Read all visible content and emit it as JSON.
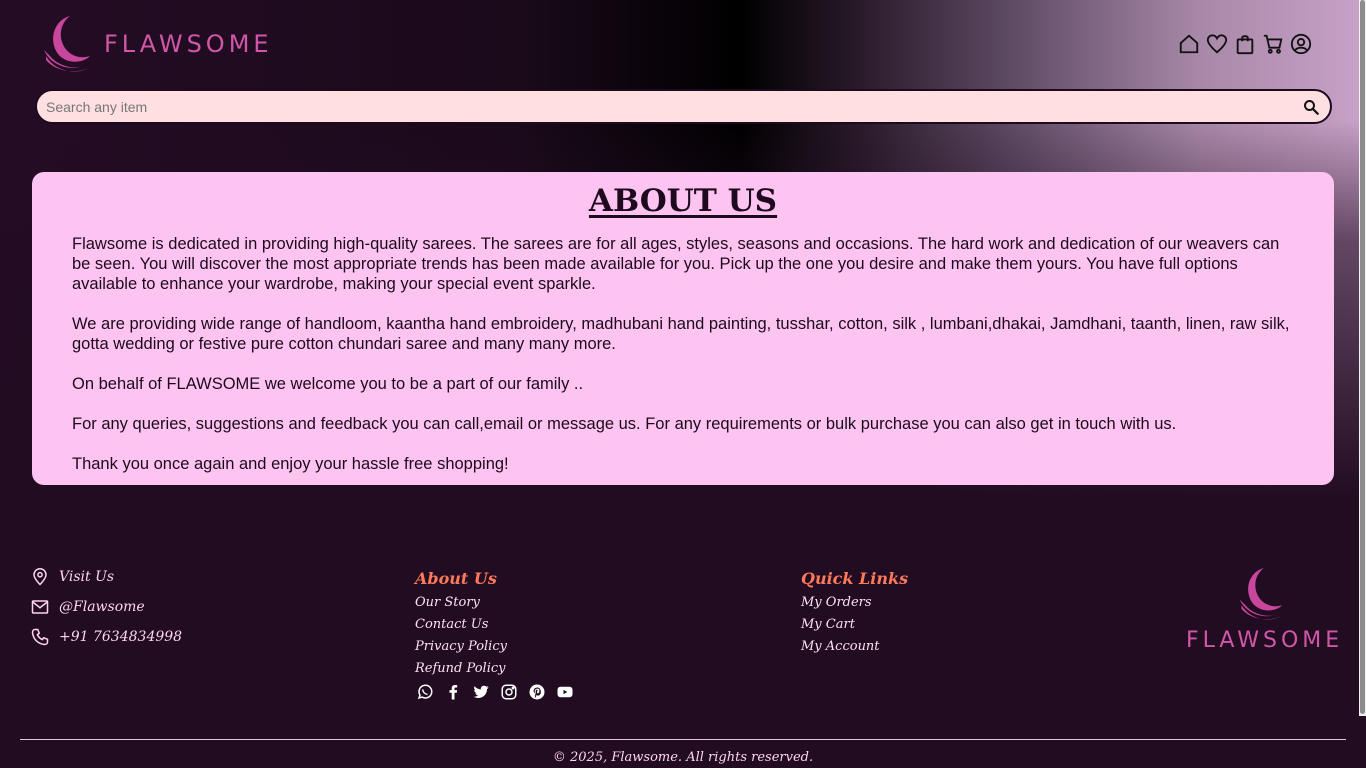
{
  "brand": {
    "name": "FLAWSOME",
    "color": "#d057a8"
  },
  "header": {
    "icons": [
      "home-icon",
      "heart-icon",
      "bag-icon",
      "cart-icon",
      "account-icon"
    ]
  },
  "search": {
    "placeholder": "Search any item",
    "value": ""
  },
  "about": {
    "title": "ABOUT US",
    "paragraphs": [
      "Flawsome is dedicated in providing high-quality sarees. The sarees are for all ages, styles, seasons and occasions. The hard work and dedication of our weavers can be seen. You will discover the most appropriate trends has been made available for you. Pick up the one you desire and make them yours. You have full options available to enhance your wardrobe, making your special event sparkle.",
      "We are providing wide range of handloom, kaantha hand embroidery, madhubani hand painting, tusshar, cotton, silk , lumbani,dhakai, Jamdhani, taanth, linen, raw silk, gotta wedding or festive pure cotton chundari saree and many many more.",
      "On behalf of FLAWSOME we welcome you to be a part of our family ..",
      "For any queries, suggestions and feedback you can call,email or message us. For any requirements or bulk purchase you can also get in touch with us.",
      "Thank you once again and enjoy your hassle free shopping!"
    ]
  },
  "footer": {
    "contact": {
      "visit": "Visit Us",
      "handle": "@Flawsome",
      "phone": "+91 7634834998"
    },
    "about": {
      "heading": "About Us",
      "links": [
        "Our Story",
        "Contact Us",
        "Privacy Policy",
        "Refund Policy"
      ]
    },
    "social_icons": [
      "whatsapp-icon",
      "facebook-icon",
      "twitter-icon",
      "instagram-icon",
      "pinterest-icon",
      "youtube-icon"
    ],
    "quick": {
      "heading": "Quick Links",
      "links": [
        "My Orders",
        "My Cart",
        "My Account"
      ]
    },
    "copyright": "© 2025, Flawsome. All rights reserved."
  }
}
